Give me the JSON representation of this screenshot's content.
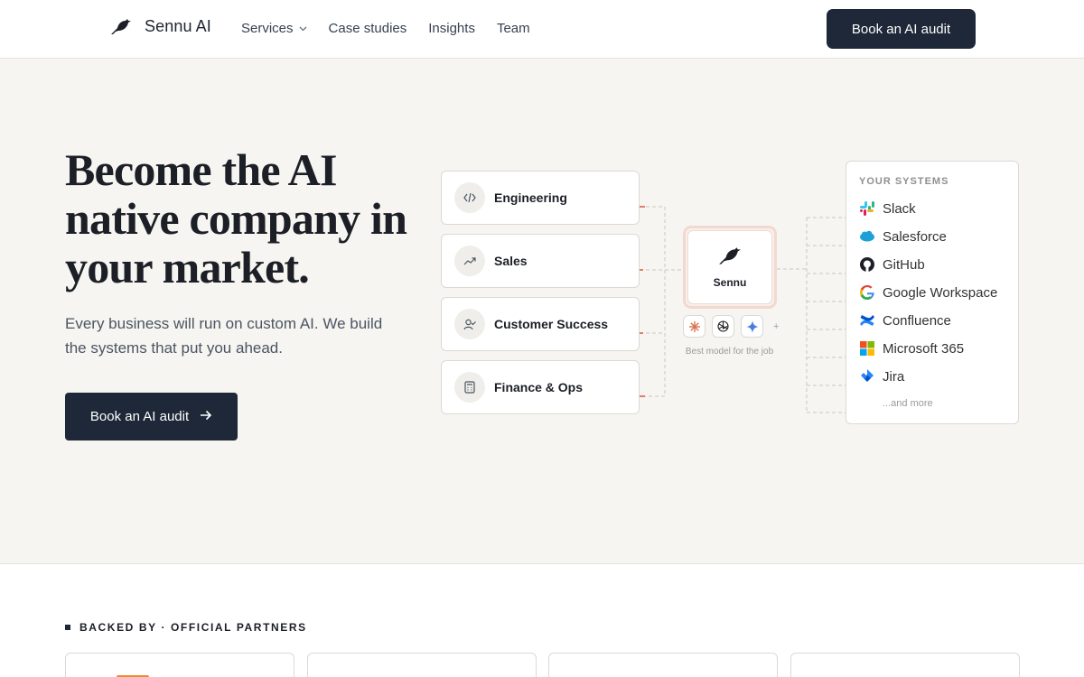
{
  "nav": {
    "brand": "Sennu AI",
    "links": [
      {
        "label": "Services",
        "has_dropdown": true
      },
      {
        "label": "Case studies"
      },
      {
        "label": "Insights"
      },
      {
        "label": "Team"
      }
    ],
    "cta": "Book an AI audit"
  },
  "hero": {
    "title": "Become the AI native company in your market.",
    "subtitle": "Every business will run on custom AI. We build the systems that put you ahead.",
    "cta": "Book an AI audit"
  },
  "diagram": {
    "departments": [
      {
        "label": "Engineering",
        "icon": "code-icon"
      },
      {
        "label": "Sales",
        "icon": "trend-up-icon"
      },
      {
        "label": "Customer Success",
        "icon": "user-check-icon"
      },
      {
        "label": "Finance & Ops",
        "icon": "calculator-icon"
      }
    ],
    "hub": {
      "label": "Sennu"
    },
    "models": [
      "claude-icon",
      "openai-icon",
      "gemini-icon"
    ],
    "models_plus": "+",
    "models_caption": "Best model for the job",
    "systems": {
      "title": "YOUR SYSTEMS",
      "items": [
        {
          "label": "Slack",
          "icon": "slack-icon"
        },
        {
          "label": "Salesforce",
          "icon": "salesforce-icon"
        },
        {
          "label": "GitHub",
          "icon": "github-icon"
        },
        {
          "label": "Google Workspace",
          "icon": "google-icon"
        },
        {
          "label": "Confluence",
          "icon": "confluence-icon"
        },
        {
          "label": "Microsoft 365",
          "icon": "microsoft-icon"
        },
        {
          "label": "Jira",
          "icon": "jira-icon"
        }
      ],
      "more": "...and more"
    }
  },
  "partners": {
    "label": "BACKED BY · OFFICIAL PARTNERS"
  },
  "colors": {
    "primary": "#1e2838",
    "hero_bg": "#f6f5f1",
    "accent_line": "#e0553b"
  }
}
